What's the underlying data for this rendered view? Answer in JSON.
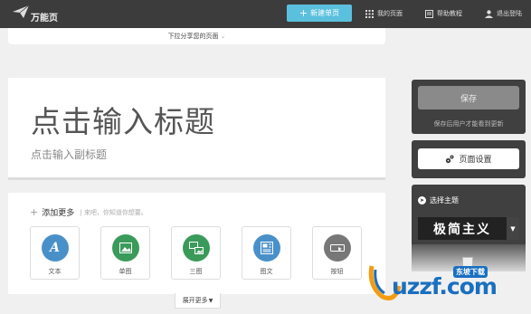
{
  "topbar": {
    "logo_text": "万能页",
    "new_page_label": "新建单页",
    "nav": [
      {
        "label": "我的页面",
        "icon": "grid-icon"
      },
      {
        "label": "帮助教程",
        "icon": "book-icon"
      },
      {
        "label": "退出登陆",
        "icon": "user-icon"
      }
    ]
  },
  "share": {
    "label": "下拉分享您的页面"
  },
  "editor": {
    "title_placeholder": "点击输入标题",
    "subtitle_placeholder": "点击输入副标题"
  },
  "add_more": {
    "heading": "添加更多",
    "hint": "| 来吧，你知道你想要。",
    "tiles": [
      {
        "label": "文本",
        "icon": "text-icon",
        "color": "#4a90c8"
      },
      {
        "label": "单图",
        "icon": "image-icon",
        "color": "#3a9a5a"
      },
      {
        "label": "三图",
        "icon": "images-icon",
        "color": "#3a9a5a"
      },
      {
        "label": "图文",
        "icon": "article-icon",
        "color": "#4a90c8"
      },
      {
        "label": "按钮",
        "icon": "button-icon",
        "color": "#777777"
      }
    ],
    "expand_label": "展开更多"
  },
  "sidebar": {
    "save_label": "保存",
    "save_note": "保存后用户才能看到更新",
    "settings_label": "页面设置",
    "theme_heading": "选择主题",
    "theme_name": "极简主义"
  },
  "watermark": {
    "text": "uzzf.com",
    "sub": "东坡下载"
  },
  "colors": {
    "accent": "#5bc0de",
    "topbar": "#3c3c3c",
    "panel": "#404040"
  }
}
